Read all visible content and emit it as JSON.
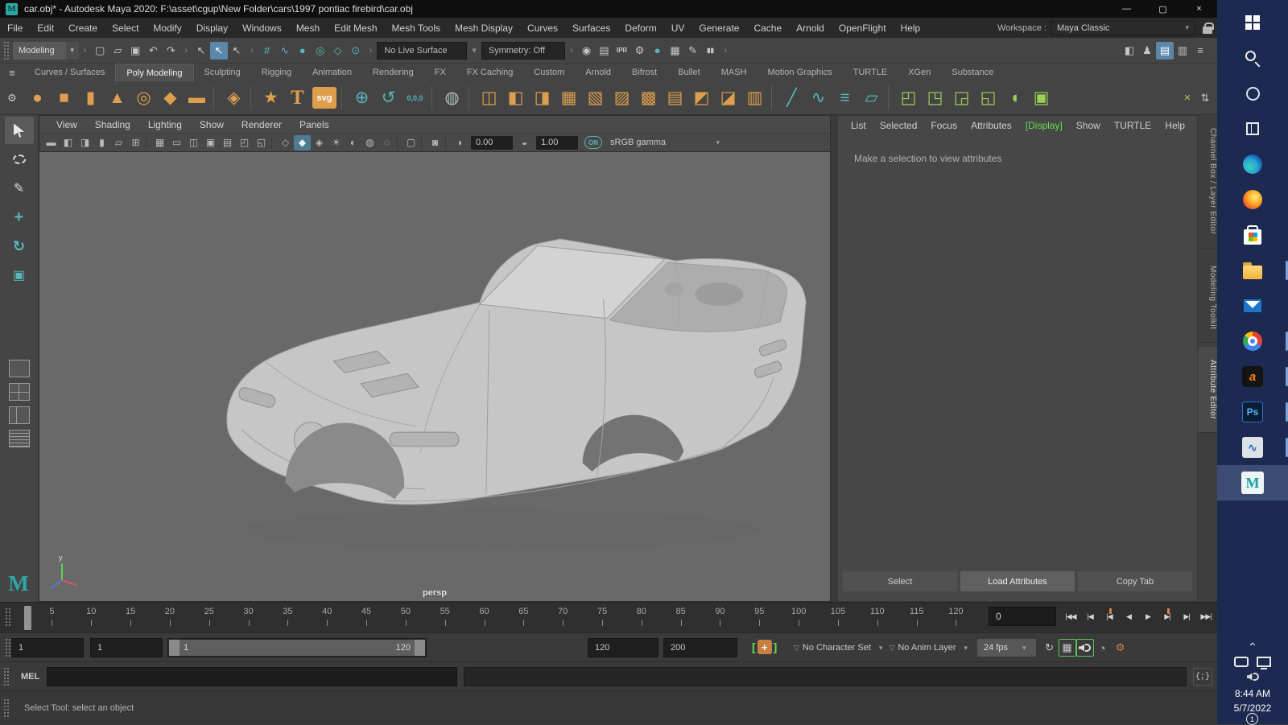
{
  "window": {
    "title": "car.obj* - Autodesk Maya 2020: F:\\asset\\cgup\\New Folder\\cars\\1997 pontiac firebird\\car.obj"
  },
  "icons": {
    "maya_logo": "M",
    "minimize": "—",
    "maximize": "▢",
    "close": "×",
    "dropdown": "▾",
    "group_arrow": "›",
    "chevron": "‹",
    "script_editor": "{;}",
    "loop": "↻",
    "snap_playback": "▦",
    "cached_playback": "◔",
    "anim_prefs": "⚙",
    "char_key": "+",
    "tri": "▽",
    "shelf_menu": "≡",
    "shelf_gear": "⚙",
    "shelf_update": "×",
    "shelf_scroll": "⇅"
  },
  "menubar": {
    "items": [
      "File",
      "Edit",
      "Create",
      "Select",
      "Modify",
      "Display",
      "Windows",
      "Mesh",
      "Edit Mesh",
      "Mesh Tools",
      "Mesh Display",
      "Curves",
      "Surfaces",
      "Deform",
      "UV",
      "Generate",
      "Cache",
      "Arnold",
      "OpenFlight",
      "Help"
    ],
    "workspace_label": "Workspace :",
    "workspace_value": "Maya Classic"
  },
  "statusline": {
    "mode": "Modeling",
    "live_surface": "No Live Surface",
    "symmetry": "Symmetry: Off",
    "file_icons": [
      {
        "name": "new-scene-icon",
        "glyph": "▢"
      },
      {
        "name": "open-scene-icon",
        "glyph": "▱"
      },
      {
        "name": "save-scene-icon",
        "glyph": "▣"
      },
      {
        "name": "undo-icon",
        "glyph": "↶"
      },
      {
        "name": "redo-icon",
        "glyph": "↷"
      }
    ],
    "selection_icons": [
      {
        "name": "select-hierarchy-icon",
        "glyph": "↖"
      },
      {
        "name": "select-object-icon",
        "glyph": "↖",
        "cls": "hl"
      },
      {
        "name": "select-component-icon",
        "glyph": "↖"
      }
    ],
    "snap_icons": [
      {
        "name": "snap-grid-icon",
        "glyph": "#",
        "color": "#56b7ba"
      },
      {
        "name": "snap-curve-icon",
        "glyph": "∿",
        "color": "#56b7ba"
      },
      {
        "name": "snap-point-icon",
        "glyph": "●",
        "color": "#56b7ba"
      },
      {
        "name": "snap-projected-center-icon",
        "glyph": "◎",
        "color": "#56b7ba"
      },
      {
        "name": "snap-view-plane-icon",
        "glyph": "◇",
        "color": "#56b7ba"
      },
      {
        "name": "make-live-icon",
        "glyph": "⊙",
        "color": "#56b7ba"
      }
    ],
    "render_icons": [
      {
        "name": "render-view-icon",
        "glyph": "◉"
      },
      {
        "name": "render-frame-icon",
        "glyph": "▤"
      },
      {
        "name": "ipr-render-icon",
        "glyph": "IPR",
        "cls": "txt"
      },
      {
        "name": "render-settings-icon",
        "glyph": "⚙"
      },
      {
        "name": "render-setup-icon",
        "glyph": "●",
        "color": "#56b7ba"
      },
      {
        "name": "light-editor-icon",
        "glyph": "▦"
      },
      {
        "name": "paint-effects-icon",
        "glyph": "✎"
      },
      {
        "name": "pause-viewport-icon",
        "glyph": "▮▮",
        "cls": "txt"
      }
    ],
    "sidebar_icons": [
      {
        "name": "modeling-toolkit-icon",
        "glyph": "◧"
      },
      {
        "name": "hik-icon",
        "glyph": "♟"
      },
      {
        "name": "channel-box-icon",
        "glyph": "▤",
        "cls": "hl"
      },
      {
        "name": "attribute-editor-icon",
        "glyph": "▥"
      },
      {
        "name": "display-layers-icon",
        "glyph": "≡"
      }
    ]
  },
  "shelf": {
    "tabs": [
      {
        "label": "Curves / Surfaces"
      },
      {
        "label": "Poly Modeling",
        "active": true
      },
      {
        "label": "Sculpting"
      },
      {
        "label": "Rigging"
      },
      {
        "label": "Animation"
      },
      {
        "label": "Rendering"
      },
      {
        "label": "FX"
      },
      {
        "label": "FX Caching"
      },
      {
        "label": "Custom"
      },
      {
        "label": "Arnold"
      },
      {
        "label": "Bifrost"
      },
      {
        "label": "Bullet"
      },
      {
        "label": "MASH"
      },
      {
        "label": "Motion Graphics"
      },
      {
        "label": "TURTLE"
      },
      {
        "label": "XGen"
      },
      {
        "label": "Substance"
      }
    ],
    "icons": [
      {
        "name": "poly-sphere-icon",
        "glyph": "●",
        "color": "#dd9e4e"
      },
      {
        "name": "poly-cube-icon",
        "glyph": "■",
        "color": "#dd9e4e"
      },
      {
        "name": "poly-cylinder-icon",
        "glyph": "▮",
        "color": "#dd9e4e"
      },
      {
        "name": "poly-cone-icon",
        "glyph": "▲",
        "color": "#dd9e4e"
      },
      {
        "name": "poly-torus-icon",
        "glyph": "◎",
        "color": "#dd9e4e"
      },
      {
        "name": "poly-plane-icon",
        "glyph": "◆",
        "color": "#dd9e4e"
      },
      {
        "name": "poly-disc-icon",
        "glyph": "▬",
        "color": "#dd9e4e"
      },
      {
        "sep": true
      },
      {
        "name": "platonic-solid-icon",
        "glyph": "◈",
        "color": "#dd9e4e"
      },
      {
        "sep": true
      },
      {
        "name": "super-shape-icon",
        "glyph": "★",
        "color": "#dd9e4e"
      },
      {
        "name": "type-tool-icon",
        "glyph": "T",
        "color": "#dd9e4e",
        "cls": "serif"
      },
      {
        "name": "svg-tool-icon",
        "glyph": "svg",
        "cls": "chip"
      },
      {
        "sep": true
      },
      {
        "name": "construction-plane-icon",
        "glyph": "⊕",
        "color": "#56b7ba"
      },
      {
        "name": "reset-time-icon",
        "glyph": "↺",
        "color": "#56b7ba"
      },
      {
        "name": "zero-transform-icon",
        "glyph": "0,0,0",
        "cls": "txt",
        "color": "#56b7ba"
      },
      {
        "sep": true
      },
      {
        "name": "smooth-preview-icon",
        "glyph": "◍",
        "color": "#aebfc0"
      },
      {
        "sep": true
      },
      {
        "name": "combine-icon",
        "glyph": "◫",
        "color": "#dd9e4e"
      },
      {
        "name": "separate-icon",
        "glyph": "◧",
        "color": "#dd9e4e"
      },
      {
        "name": "extract-icon",
        "glyph": "◨",
        "color": "#dd9e4e"
      },
      {
        "name": "boolean-union-icon",
        "glyph": "▦",
        "color": "#dd9e4e"
      },
      {
        "name": "boolean-difference-icon",
        "glyph": "▧",
        "color": "#dd9e4e"
      },
      {
        "name": "boolean-intersect-icon",
        "glyph": "▨",
        "color": "#dd9e4e"
      },
      {
        "name": "smooth-mesh-icon",
        "glyph": "▩",
        "color": "#dd9e4e"
      },
      {
        "name": "reduce-mesh-icon",
        "glyph": "▤",
        "color": "#dd9e4e"
      },
      {
        "name": "triangulate-icon",
        "glyph": "◩",
        "color": "#dd9e4e"
      },
      {
        "name": "quadrangulate-icon",
        "glyph": "◪",
        "color": "#dd9e4e"
      },
      {
        "name": "fill-hole-icon",
        "glyph": "▥",
        "color": "#dd9e4e"
      },
      {
        "sep": true
      },
      {
        "name": "multi-cut-icon",
        "glyph": "╱",
        "color": "#56b7ba"
      },
      {
        "name": "connect-tool-icon",
        "glyph": "∿",
        "color": "#56b7ba"
      },
      {
        "name": "insert-edge-loop-icon",
        "glyph": "≡",
        "color": "#56b7ba"
      },
      {
        "name": "quad-draw-icon",
        "glyph": "▱",
        "color": "#56b7ba"
      },
      {
        "sep": true
      },
      {
        "name": "mirror-icon",
        "glyph": "◰",
        "color": "#9ccf55"
      },
      {
        "name": "symmetry-icon",
        "glyph": "◳",
        "color": "#9ccf55"
      },
      {
        "name": "target-weld-icon",
        "glyph": "◲",
        "color": "#9ccf55"
      },
      {
        "name": "average-vertices-icon",
        "glyph": "◱",
        "color": "#9ccf55"
      },
      {
        "name": "sculpt-tool-icon",
        "glyph": "◖",
        "color": "#9ccf55"
      },
      {
        "name": "uv-editor-icon",
        "glyph": "▣",
        "color": "#9ccf55"
      }
    ]
  },
  "toolbox": {
    "tools": [
      {
        "name": "select-tool",
        "cls": "t-select",
        "active": true
      },
      {
        "name": "lasso-tool",
        "cls": "t-lasso"
      },
      {
        "name": "paint-select-tool",
        "cls": "t-paint"
      },
      {
        "name": "move-tool",
        "cls": "t-move"
      },
      {
        "name": "rotate-tool",
        "cls": "t-rotate"
      },
      {
        "name": "scale-tool",
        "cls": "t-scale"
      }
    ]
  },
  "viewport": {
    "menus": [
      "View",
      "Shading",
      "Lighting",
      "Show",
      "Renderer",
      "Panels"
    ],
    "toolbar_icons": [
      {
        "name": "select-camera-icon",
        "glyph": "▬"
      },
      {
        "name": "lock-camera-icon",
        "glyph": "◧"
      },
      {
        "name": "camera-attributes-icon",
        "glyph": "◨"
      },
      {
        "name": "bookmark-icon",
        "glyph": "▮"
      },
      {
        "name": "image-plane-icon",
        "glyph": "▱"
      },
      {
        "name": "pan-zoom-icon",
        "glyph": "⊞"
      },
      {
        "sep": true
      },
      {
        "name": "grid-icon",
        "glyph": "▦"
      },
      {
        "name": "film-gate-icon",
        "glyph": "▭"
      },
      {
        "name": "resolution-gate-icon",
        "glyph": "◫"
      },
      {
        "name": "gate-mask-icon",
        "glyph": "▣"
      },
      {
        "name": "field-chart-icon",
        "glyph": "▤"
      },
      {
        "name": "safe-action-icon",
        "glyph": "◰"
      },
      {
        "name": "safe-title-icon",
        "glyph": "◱"
      },
      {
        "sep": true
      },
      {
        "name": "wireframe-icon",
        "glyph": "◇"
      },
      {
        "name": "shaded-mode-icon",
        "glyph": "◆",
        "cls": "hl"
      },
      {
        "name": "textured-mode-icon",
        "glyph": "◈"
      },
      {
        "name": "use-all-lights-icon",
        "glyph": "☀"
      },
      {
        "name": "shadows-icon",
        "glyph": "◐"
      },
      {
        "name": "ao-icon",
        "glyph": "◍"
      },
      {
        "name": "motion-blur-icon",
        "glyph": "◌"
      },
      {
        "sep": true
      },
      {
        "name": "isolate-select-icon",
        "glyph": "▢"
      },
      {
        "sep": true
      },
      {
        "name": "xray-icon",
        "glyph": "◙"
      },
      {
        "sep": true
      }
    ],
    "exposure": "0.00",
    "gamma": "1.00",
    "on_label": "ON",
    "color_space": "sRGB gamma",
    "camera_label": "persp"
  },
  "attribute_editor": {
    "menus": [
      {
        "label": "List"
      },
      {
        "label": "Selected"
      },
      {
        "label": "Focus"
      },
      {
        "label": "Attributes"
      },
      {
        "label": "[Display]",
        "cls": "green"
      },
      {
        "label": "Show"
      },
      {
        "label": "TURTLE"
      },
      {
        "label": "Help"
      }
    ],
    "message": "Make a selection to view attributes",
    "buttons": [
      {
        "name": "select-button",
        "label": "Select"
      },
      {
        "name": "load-attributes-button",
        "label": "Load Attributes",
        "active": true
      },
      {
        "name": "copy-tab-button",
        "label": "Copy Tab"
      }
    ]
  },
  "side_tabs": [
    {
      "name": "tab-channel-box",
      "label": "Channel Box / Layer Editor"
    },
    {
      "name": "tab-modeling-toolkit",
      "label": "Modeling Toolkit"
    },
    {
      "name": "tab-attribute-editor",
      "label": "Attribute Editor",
      "active": true
    }
  ],
  "timeline": {
    "ticks": [
      5,
      10,
      15,
      20,
      25,
      30,
      35,
      40,
      45,
      50,
      55,
      60,
      65,
      70,
      75,
      80,
      85,
      90,
      95,
      100,
      105,
      110,
      115,
      120
    ],
    "current_frame": "0",
    "playback_buttons": [
      {
        "name": "go-to-start-button",
        "glyph": "|◀◀"
      },
      {
        "name": "step-back-frame-button",
        "glyph": "|◀"
      },
      {
        "name": "step-back-key-button",
        "glyph": "|◀",
        "cls": "key"
      },
      {
        "name": "play-backwards-button",
        "glyph": "◀"
      },
      {
        "name": "play-forwards-button",
        "glyph": "▶"
      },
      {
        "name": "step-forward-key-button",
        "glyph": "▶|",
        "cls": "key"
      },
      {
        "name": "step-forward-frame-button",
        "glyph": "▶|"
      },
      {
        "name": "go-to-end-button",
        "glyph": "▶▶|"
      }
    ]
  },
  "range_slider": {
    "anim_start": "1",
    "playback_start": "1",
    "slider_start": "1",
    "slider_end": "120",
    "playback_end": "120",
    "anim_end": "200"
  },
  "playback_options": {
    "character_set": "No Character Set",
    "anim_layer": "No Anim Layer",
    "fps": "24 fps"
  },
  "command_line": {
    "label": "MEL",
    "input_value": ""
  },
  "help_line": {
    "text": "Select Tool: select an object"
  },
  "taskbar": {
    "time": "8:44 AM",
    "date": "5/7/2022",
    "badge": "1",
    "icons": [
      {
        "name": "start-button",
        "cls": "ic-winlogo"
      },
      {
        "name": "search-icon",
        "cls": "ic-search"
      },
      {
        "name": "cortana-icon",
        "cls": "ic-cortana"
      },
      {
        "name": "task-view-icon",
        "cls": "ic-taskview"
      },
      {
        "name": "edge-icon",
        "cls": "ic-edge"
      },
      {
        "name": "firefox-icon",
        "cls": "ic-firefox"
      },
      {
        "name": "store-icon",
        "cls": "ic-store"
      },
      {
        "name": "file-explorer-icon",
        "cls": "ic-folder",
        "run": true
      },
      {
        "name": "mail-icon",
        "cls": "ic-mail"
      },
      {
        "name": "chrome-icon",
        "cls": "ic-chrome",
        "run": true
      },
      {
        "name": "aba-app-icon",
        "cls": "ic-aba",
        "run": true
      },
      {
        "name": "photoshop-icon",
        "cls": "ic-ps",
        "run": true
      },
      {
        "name": "media-app-icon",
        "cls": "ic-media",
        "run": true
      },
      {
        "name": "maya-taskbar-icon",
        "cls": "ic-maya",
        "active": true
      }
    ]
  }
}
